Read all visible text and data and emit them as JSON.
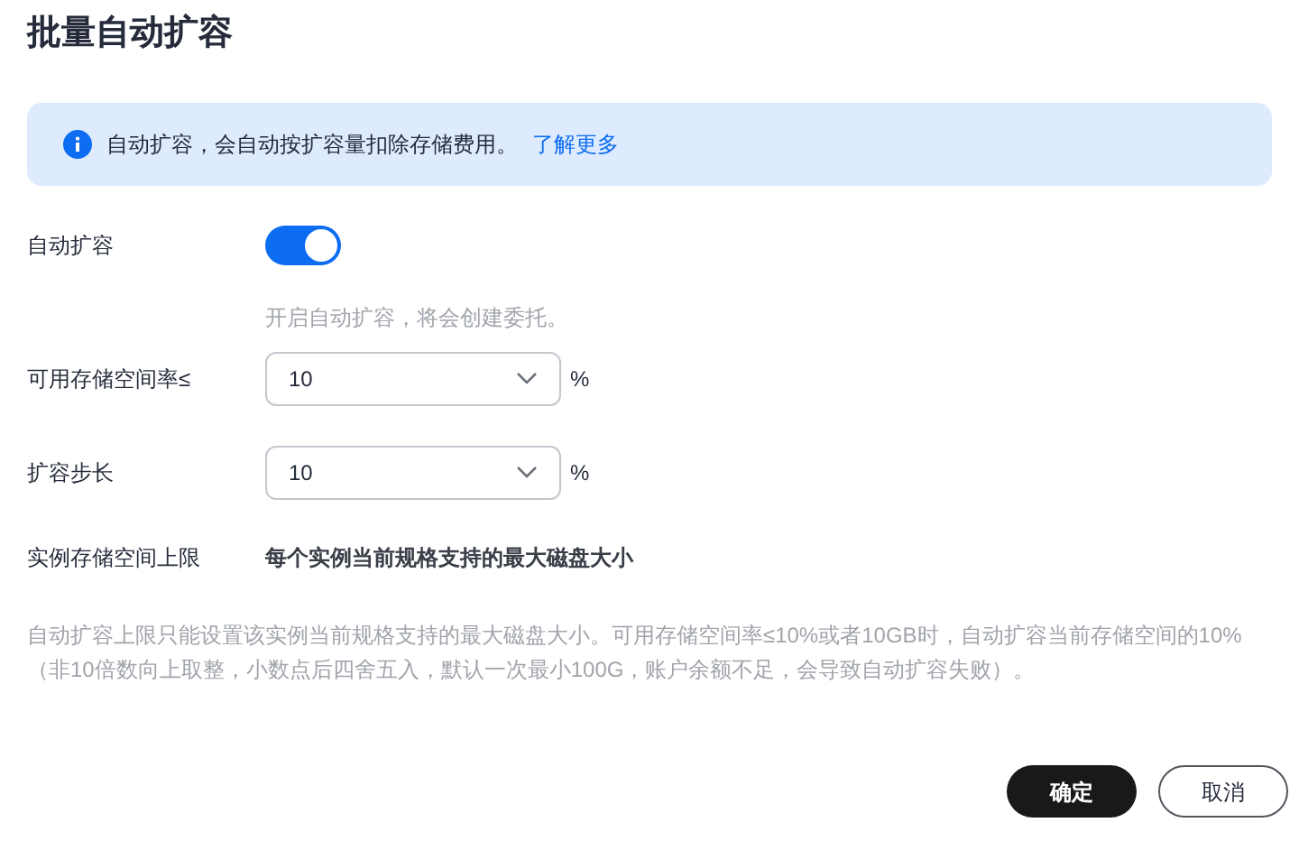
{
  "dialog": {
    "title": "批量自动扩容"
  },
  "banner": {
    "text": "自动扩容，会自动按扩容量扣除存储费用。",
    "link": "了解更多"
  },
  "auto_scale": {
    "label": "自动扩容",
    "on": true,
    "hint": "开启自动扩容，将会创建委托。"
  },
  "selects": [
    {
      "label": "可用存储空间率≤",
      "value": "10",
      "unit": "%"
    },
    {
      "label": "扩容步长",
      "value": "10",
      "unit": "%"
    }
  ],
  "limit": {
    "label": "实例存储空间上限",
    "value": "每个实例当前规格支持的最大磁盘大小"
  },
  "note": "自动扩容上限只能设置该实例当前规格支持的最大磁盘大小。可用存储空间率≤10%或者10GB时，自动扩容当前存储空间的10%（非10倍数向上取整，小数点后四舍五入，默认一次最小100G，账户余额不足，会导致自动扩容失败）。",
  "buttons": [
    {
      "label": "确定",
      "kind": "primary"
    },
    {
      "label": "取消",
      "kind": "secondary"
    }
  ]
}
